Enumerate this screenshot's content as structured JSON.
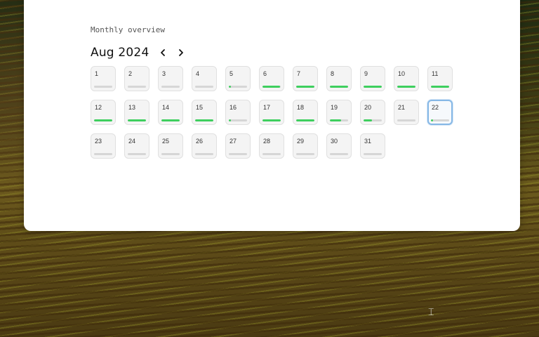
{
  "card": {
    "subtitle": "Monthly overview",
    "month_label": "Aug 2024",
    "prev_icon": "chevron-left-icon",
    "next_icon": "chevron-right-icon"
  },
  "colors": {
    "progress": "#3ecf5e",
    "track": "#d6d6d6",
    "selected_border": "#86b8e6"
  },
  "selected_day": 22,
  "days": [
    {
      "label": "1",
      "progress": 0
    },
    {
      "label": "2",
      "progress": 0
    },
    {
      "label": "3",
      "progress": 0
    },
    {
      "label": "4",
      "progress": 0
    },
    {
      "label": "5",
      "progress": 0.1
    },
    {
      "label": "6",
      "progress": 0.95
    },
    {
      "label": "7",
      "progress": 1
    },
    {
      "label": "8",
      "progress": 1
    },
    {
      "label": "9",
      "progress": 1
    },
    {
      "label": "10",
      "progress": 1
    },
    {
      "label": "11",
      "progress": 1
    },
    {
      "label": "12",
      "progress": 1
    },
    {
      "label": "13",
      "progress": 1
    },
    {
      "label": "14",
      "progress": 1
    },
    {
      "label": "15",
      "progress": 1
    },
    {
      "label": "16",
      "progress": 0.1
    },
    {
      "label": "17",
      "progress": 1
    },
    {
      "label": "18",
      "progress": 1
    },
    {
      "label": "19",
      "progress": 0.6
    },
    {
      "label": "20",
      "progress": 0.45
    },
    {
      "label": "21",
      "progress": 0
    },
    {
      "label": "22",
      "progress": 0.1
    },
    {
      "label": "23",
      "progress": 0
    },
    {
      "label": "24",
      "progress": 0
    },
    {
      "label": "25",
      "progress": 0
    },
    {
      "label": "26",
      "progress": 0
    },
    {
      "label": "27",
      "progress": 0
    },
    {
      "label": "28",
      "progress": 0
    },
    {
      "label": "29",
      "progress": 0
    },
    {
      "label": "30",
      "progress": 0
    },
    {
      "label": "31",
      "progress": 0
    }
  ]
}
